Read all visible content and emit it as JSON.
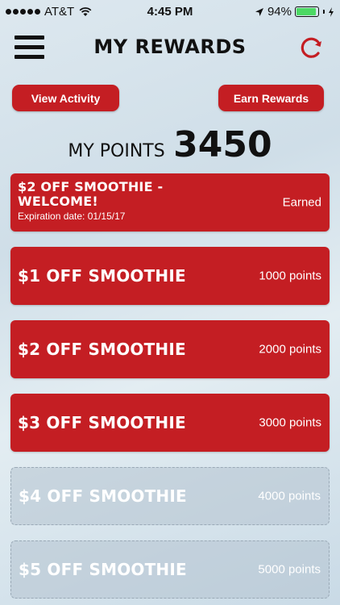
{
  "status_bar": {
    "carrier": "AT&T",
    "time": "4:45 PM",
    "battery_percent": "94%",
    "battery_level": 0.94,
    "signal_bars": 5
  },
  "header": {
    "title": "MY REWARDS",
    "menu_icon": "hamburger-menu-icon",
    "refresh_icon": "refresh-icon"
  },
  "actions": {
    "view_activity": "View Activity",
    "earn_rewards": "Earn Rewards"
  },
  "points": {
    "label": "MY POINTS",
    "value": "3450"
  },
  "rewards": [
    {
      "name": "$2 OFF SMOOTHIE - WELCOME!",
      "status": "Earned",
      "expiration": "Expiration date: 01/15/17"
    },
    {
      "name": "$1 OFF SMOOTHIE",
      "status": "1000 points"
    },
    {
      "name": "$2 OFF SMOOTHIE",
      "status": "2000 points"
    },
    {
      "name": "$3 OFF SMOOTHIE",
      "status": "3000 points"
    },
    {
      "name": "$4 OFF SMOOTHIE",
      "status": "4000 points"
    },
    {
      "name": "$5 OFF SMOOTHIE",
      "status": "5000 points"
    }
  ],
  "colors": {
    "accent": "#c41e23",
    "battery": "#4cd964",
    "locked": "#b4c3d0"
  }
}
